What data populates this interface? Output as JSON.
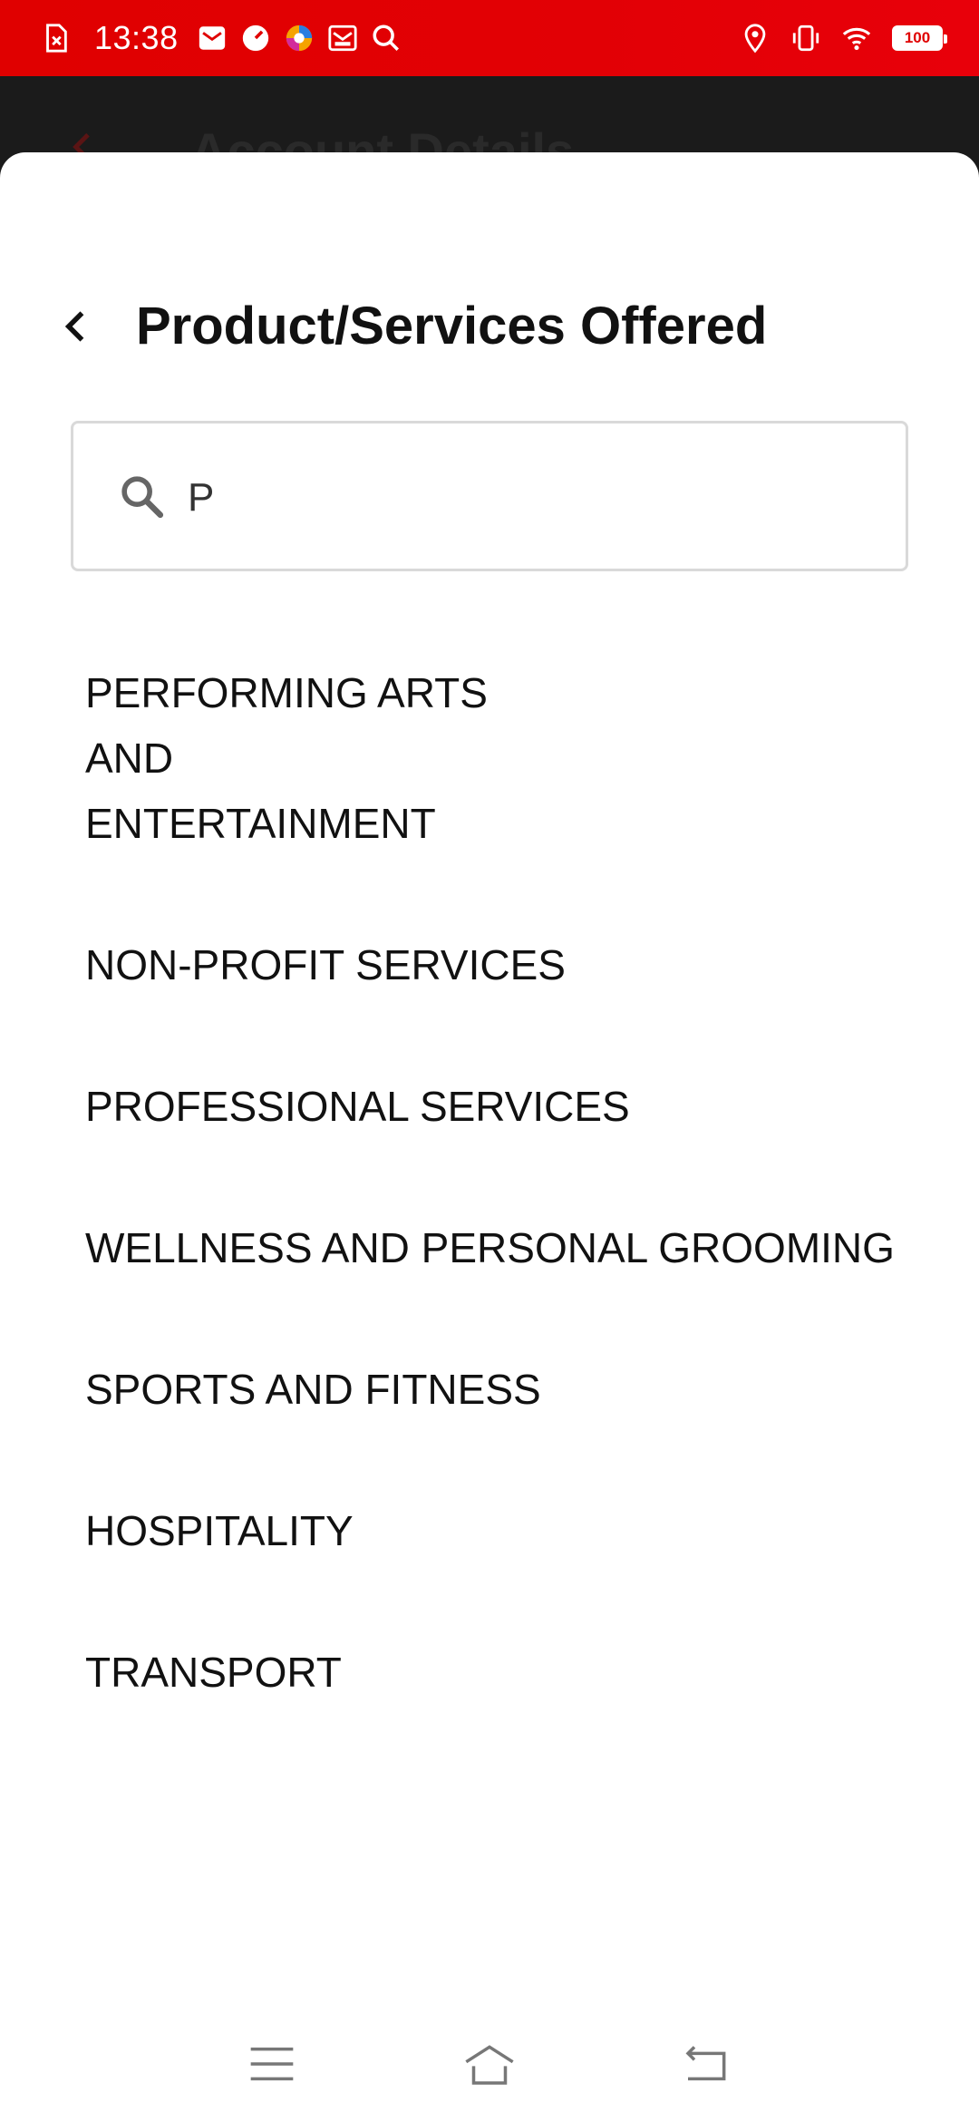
{
  "status_bar": {
    "time": "13:38",
    "battery": "100",
    "left_icons": [
      "sim-error-icon",
      "mail-icon",
      "speed-icon",
      "browser-icon",
      "mailbox-icon",
      "search-icon"
    ],
    "right_icons": [
      "location-icon",
      "vibrate-icon",
      "wifi-icon"
    ]
  },
  "background": {
    "title": "Account Details"
  },
  "sheet": {
    "title": "Product/Services Offered",
    "search": {
      "value": "P",
      "placeholder": ""
    },
    "options": [
      {
        "label": "PERFORMING ARTS AND ENTERTAINMENT"
      },
      {
        "label": "NON-PROFIT SERVICES"
      },
      {
        "label": "PROFESSIONAL SERVICES"
      },
      {
        "label": "WELLNESS AND PERSONAL GROOMING"
      },
      {
        "label": "SPORTS AND FITNESS"
      },
      {
        "label": "HOSPITALITY"
      },
      {
        "label": "TRANSPORT"
      }
    ]
  },
  "colors": {
    "status_bar": "#e00000",
    "sheet_bg": "#ffffff",
    "text": "#111111",
    "border": "#d9d9d9"
  }
}
